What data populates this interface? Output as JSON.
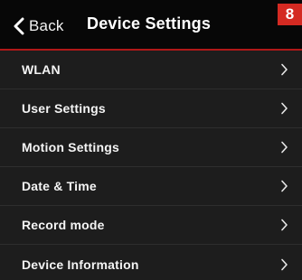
{
  "header": {
    "back_label": "Back",
    "title": "Device Settings",
    "badge": "8"
  },
  "menu": {
    "items": [
      {
        "label": "WLAN",
        "icon": "chevron-right-icon"
      },
      {
        "label": "User Settings",
        "icon": "chevron-right-icon"
      },
      {
        "label": "Motion Settings",
        "icon": "chevron-right-icon"
      },
      {
        "label": "Date & Time",
        "icon": "chevron-right-icon"
      },
      {
        "label": "Record mode",
        "icon": "chevron-right-icon"
      },
      {
        "label": "Device Information",
        "icon": "chevron-right-icon"
      }
    ]
  },
  "colors": {
    "accent": "#b01818",
    "badge": "#d42a22",
    "background": "#1d1d1d",
    "header": "#070707"
  }
}
